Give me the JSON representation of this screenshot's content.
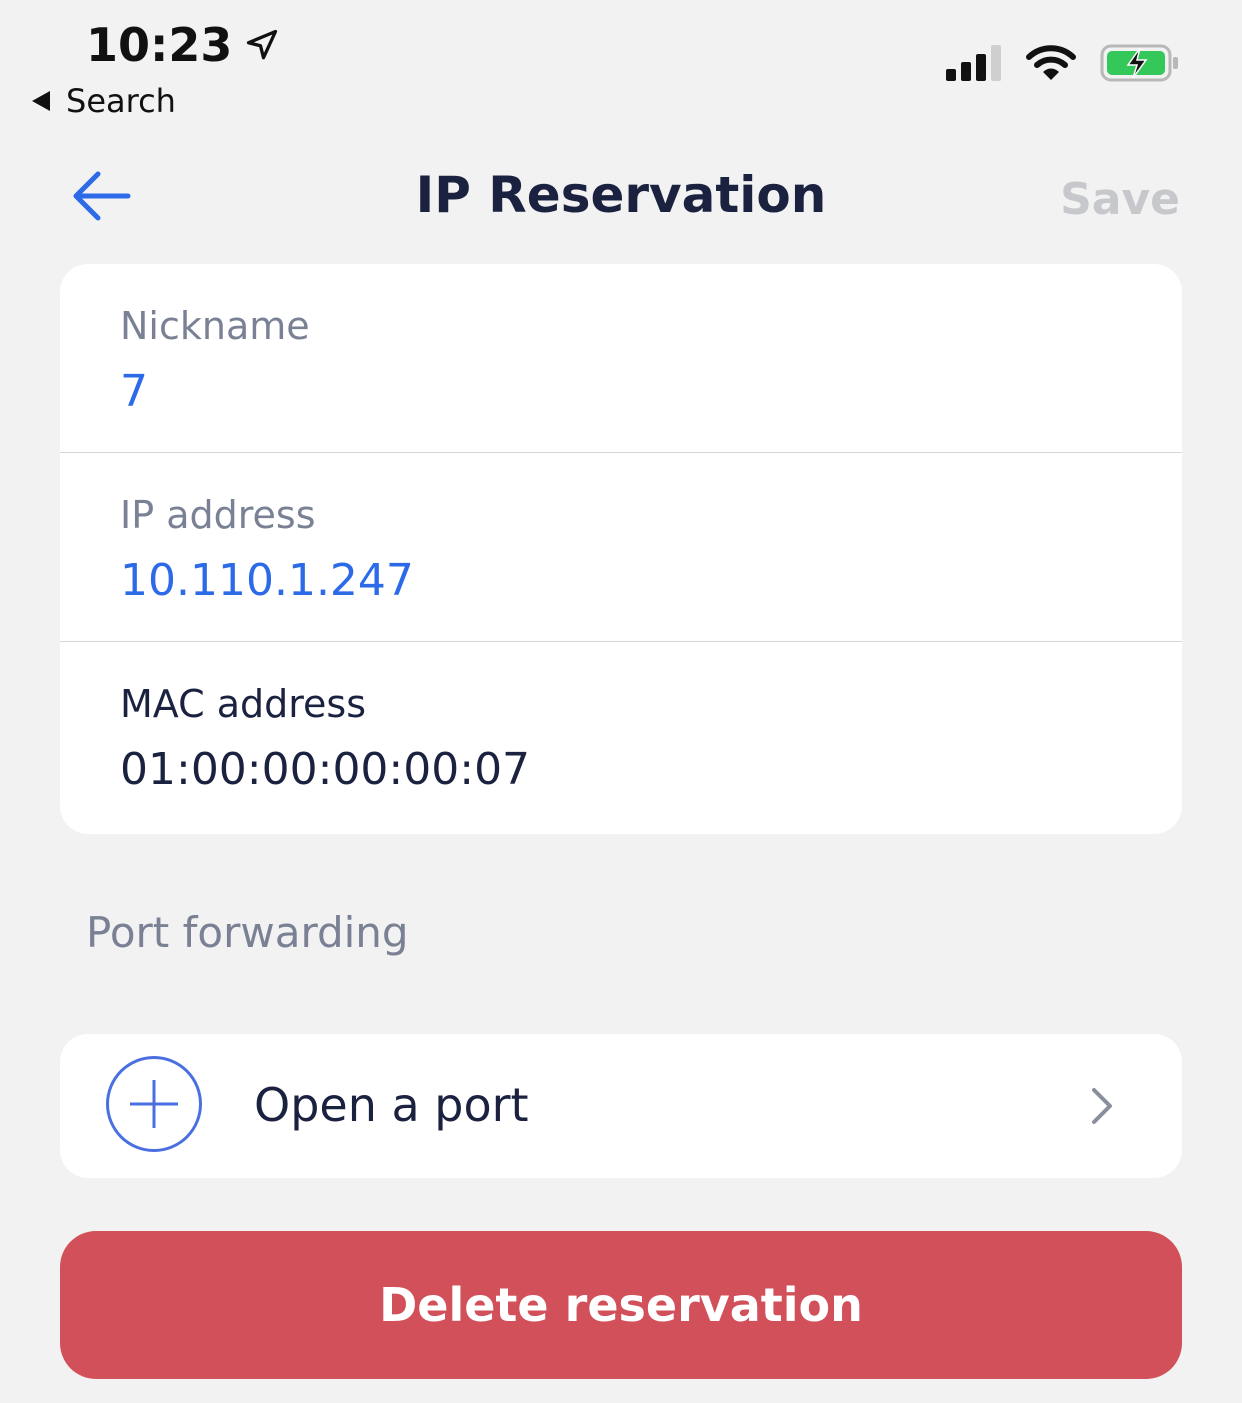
{
  "status_bar": {
    "time": "10:23",
    "back_label": "Search"
  },
  "nav": {
    "title": "IP Reservation",
    "save_label": "Save"
  },
  "fields": [
    {
      "label": "Nickname",
      "value": "7"
    },
    {
      "label": "IP address",
      "value": "10.110.1.247"
    },
    {
      "label": "MAC address",
      "value": "01:00:00:00:00:07"
    }
  ],
  "port_forwarding": {
    "section_title": "Port forwarding",
    "open_port_label": "Open a port"
  },
  "delete_button": {
    "label": "Delete reservation"
  },
  "colors": {
    "accent": "#2c6ae8",
    "danger": "#d1505a",
    "background": "#f2f2f2",
    "battery": "#34c759"
  },
  "icons": [
    "location-arrow-icon",
    "signal-icon",
    "wifi-icon",
    "battery-charging-icon",
    "back-arrow-icon",
    "plus-circle-icon",
    "chevron-right-icon"
  ]
}
